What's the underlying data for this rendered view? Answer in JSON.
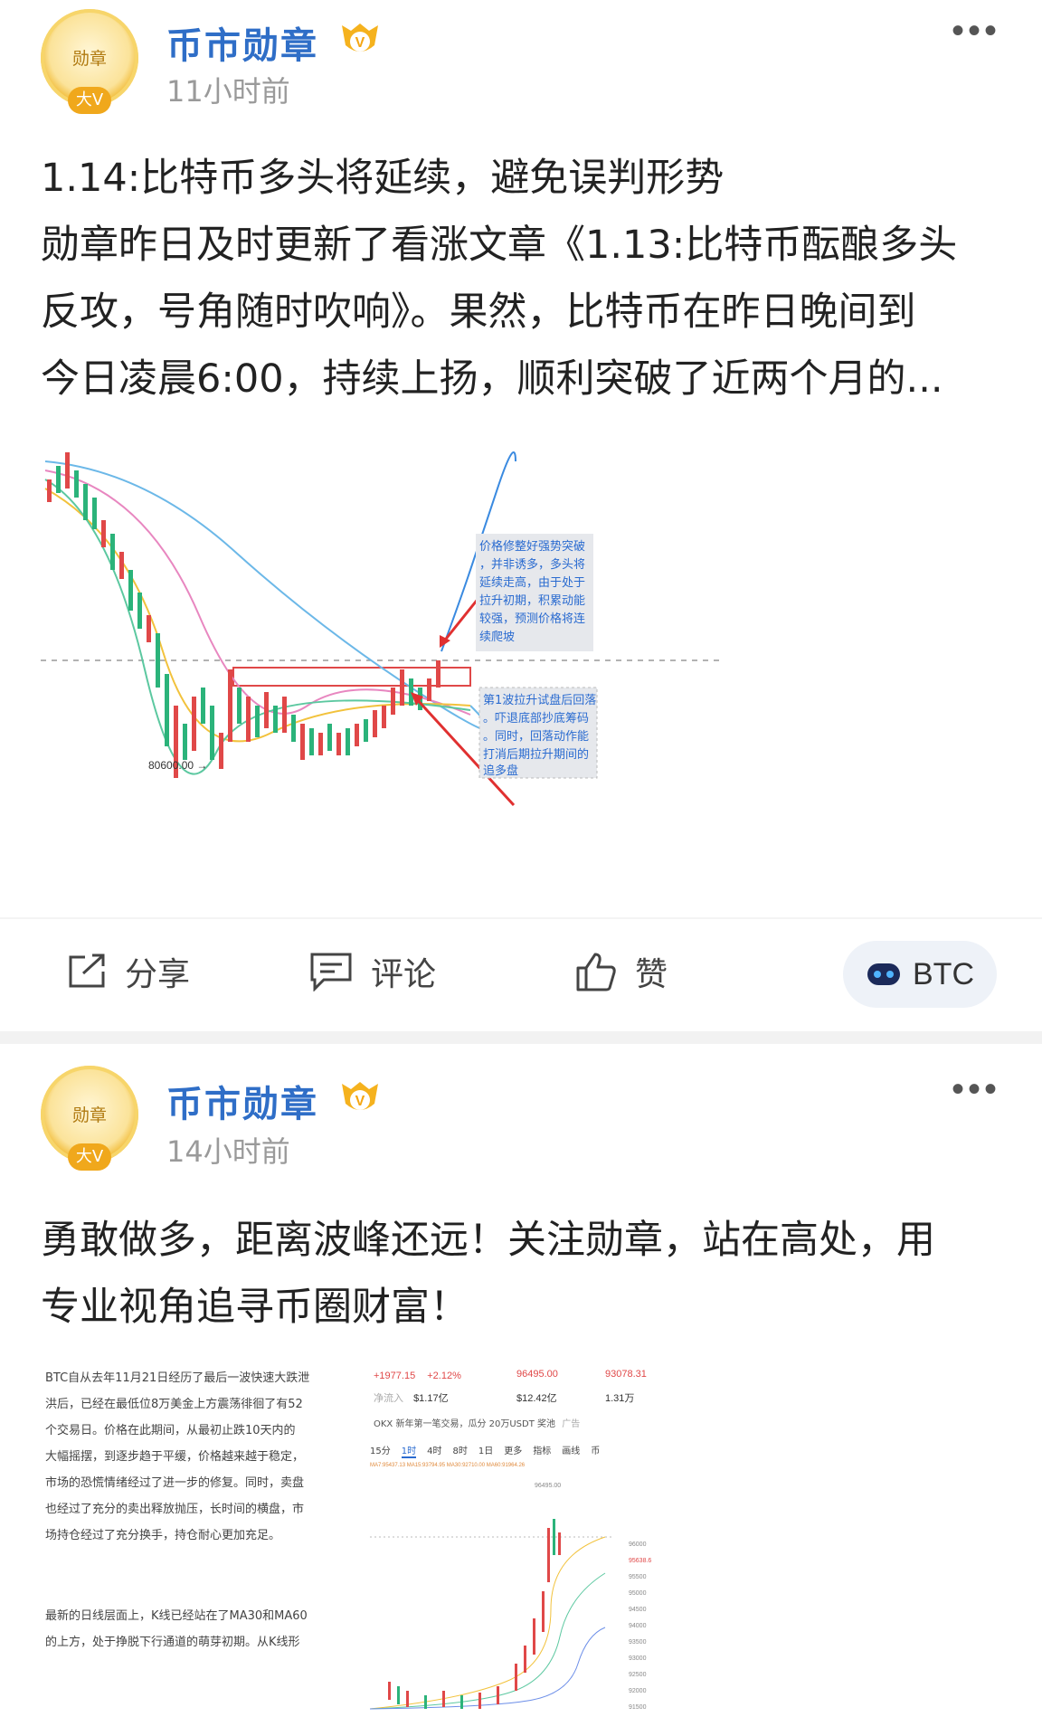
{
  "posts": [
    {
      "author": "币市勋章",
      "avatar_text": "勋章",
      "avatar_badge": "大V",
      "time": "11小时前",
      "text_lines": [
        "1.14:比特币多头将延续，避免误判形势",
        "勋章昨日及时更新了看涨文章《1.13:比特币酝酿多头",
        "反攻，号角随时吹响》。果然，比特币在昨日晚间到",
        "今日凌晨6:00，持续上扬，顺利突破了近两个月的..."
      ],
      "chart": {
        "price_label": "80600.00 →",
        "note_top": [
          "价格修整好强势突破",
          "，并非诱多，多头将",
          "延续走高，由于处于",
          "拉升初期，积累动能",
          "较强，预测价格将连",
          "续爬坡"
        ],
        "note_bottom": [
          "第1波拉升试盘后回落",
          "。吓退底部抄底筹码",
          "。同时，回落动作能",
          "打消后期拉升期间的",
          "追多盘"
        ]
      },
      "actions": {
        "share": "分享",
        "comment": "评论",
        "like": "赞",
        "tag": "BTC"
      }
    },
    {
      "author": "币市勋章",
      "avatar_text": "勋章",
      "avatar_badge": "大V",
      "time": "14小时前",
      "text_lines": [
        "勇敢做多，距离波峰还远！关注勋章，站在高处，用",
        "专业视角追寻币圈财富！"
      ],
      "image_left_lines": [
        "BTC自从去年11月21日经历了最后一波快速大跌泄",
        "洪后，已经在最低位8万美金上方震荡徘徊了有52",
        "个交易日。价格在此期间，从最初止跌10天内的",
        "大幅摇摆，到逐步趋于平缓，价格越来越于稳定，",
        "市场的恐慌情绪经过了进一步的修复。同时，卖盘",
        "也经过了充分的卖出释放抛压，长时间的横盘，市",
        "场持仓经过了充分换手，持仓耐心更加充足。"
      ],
      "image_left_lines_b": [
        "最新的日线层面上，K线已经站在了MA30和MA60",
        "的上方，处于挣脱下行通道的萌芽初期。从K线形"
      ],
      "image_right": {
        "change": "+1977.15",
        "change_pct": "+2.12%",
        "high": "96495.00",
        "price": "93078.31",
        "label_net": "净流入",
        "net": "$1.17亿",
        "vol": "$12.42亿",
        "vol2": "1.31万",
        "banner": "OKX 新年第一笔交易，瓜分 20万USDT 奖池",
        "banner_ad": "广告",
        "tabs": [
          "15分",
          "1时",
          "4时",
          "8时",
          "1日",
          "更多",
          "指标",
          "画线",
          "币"
        ],
        "ma_line": "MA7:95437.13  MA15:93794.95  MA30:92710.00  MA60:91964.26",
        "peak": "96495.00",
        "axis": [
          "96000",
          "95500",
          "95000",
          "94500",
          "94000",
          "93500",
          "93000",
          "92500",
          "92000",
          "91500"
        ],
        "current": "95638.6"
      }
    }
  ]
}
